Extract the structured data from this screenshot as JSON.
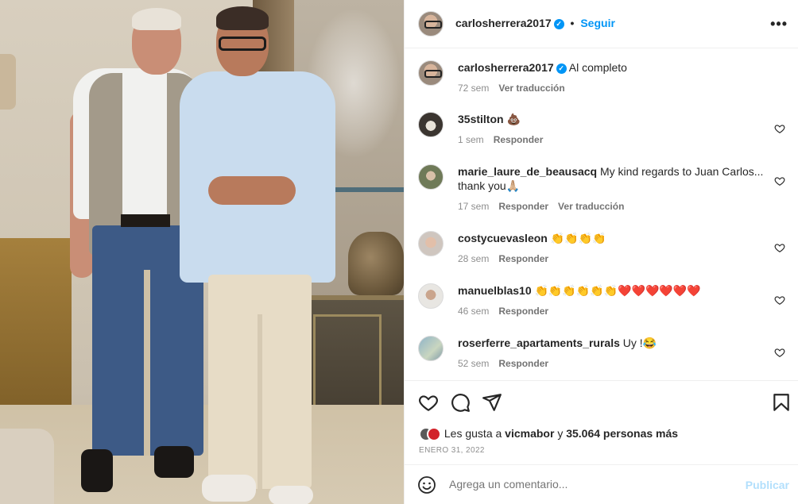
{
  "header": {
    "username": "carlosherrera2017",
    "separator": "•",
    "follow_label": "Seguir",
    "more_icon": "more-horizontal-icon"
  },
  "caption": {
    "username": "carlosherrera2017",
    "text": "Al completo",
    "time": "72 sem",
    "translate": "Ver traducción"
  },
  "comments": [
    {
      "username": "35stilton",
      "text": "💩",
      "time": "1 sem",
      "reply": "Responder",
      "translate": ""
    },
    {
      "username": "marie_laure_de_beausacq",
      "text": "My kind regards to Juan Carlos... thank you🙏🏼",
      "time": "17 sem",
      "reply": "Responder",
      "translate": "Ver traducción"
    },
    {
      "username": "costycuevasleon",
      "text": "👏👏👏👏",
      "time": "28 sem",
      "reply": "Responder",
      "translate": ""
    },
    {
      "username": "manuelblas10",
      "text": "👏👏👏👏👏👏❤️❤️❤️❤️❤️❤️",
      "time": "46 sem",
      "reply": "Responder",
      "translate": ""
    },
    {
      "username": "roserferre_apartaments_rurals",
      "text": "Uy !😂",
      "time": "52 sem",
      "reply": "Responder",
      "translate": ""
    }
  ],
  "likes": {
    "prefix": "Les gusta a",
    "user": "vicmabor",
    "conj": "y",
    "count": "35.064 personas más"
  },
  "date": "ENERO 31, 2022",
  "add_comment": {
    "placeholder": "Agrega un comentario...",
    "publish": "Publicar"
  },
  "colors": {
    "accent": "#0095f6",
    "publish_disabled": "#b2dffc",
    "muted": "#8e8e8e"
  }
}
